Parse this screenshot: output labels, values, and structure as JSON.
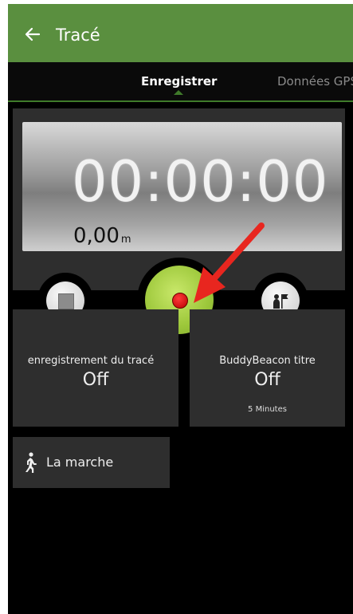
{
  "app": {
    "title": "Tracé"
  },
  "tabs": [
    {
      "label": "Enregistrer",
      "active": true
    },
    {
      "label": "Données GPS",
      "active": false
    }
  ],
  "timer": {
    "elapsed": "00:00:00",
    "distance_value": "0,00",
    "distance_unit": "m"
  },
  "controls": {
    "stop_icon": "stop-icon",
    "record_icon": "record-icon",
    "buddy_icon": "buddy-flag-icon"
  },
  "cards": {
    "recording": {
      "label": "enregistrement du tracé",
      "value": "Off"
    },
    "buddybeacon": {
      "label": "BuddyBeacon titre",
      "value": "Off",
      "sub": "5 Minutes"
    }
  },
  "activity": {
    "label": "La marche",
    "icon": "walk-icon"
  },
  "colors": {
    "app_bar": "#5a8f3f",
    "record_button": "#9cc73a",
    "record_dot": "#d40000",
    "annotation_arrow": "#e8261f"
  }
}
